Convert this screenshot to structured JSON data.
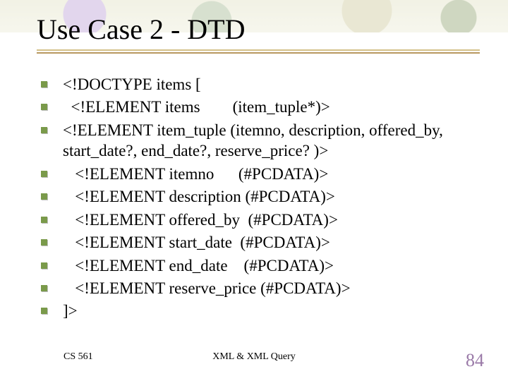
{
  "title": "Use Case 2 - DTD",
  "bullets": [
    "<!DOCTYPE items [",
    "  <!ELEMENT items        (item_tuple*)>",
    "  <!ELEMENT item_tuple  (itemno, description, offered_by, start_date?, end_date?, reserve_price? )>",
    "   <!ELEMENT itemno      (#PCDATA)>",
    "   <!ELEMENT description (#PCDATA)>",
    "   <!ELEMENT offered_by  (#PCDATA)>",
    "   <!ELEMENT start_date  (#PCDATA)>",
    "   <!ELEMENT end_date    (#PCDATA)>",
    "   <!ELEMENT reserve_price (#PCDATA)>",
    "]>"
  ],
  "footer": {
    "left": "CS 561",
    "center": "XML & XML Query",
    "page": "84"
  }
}
